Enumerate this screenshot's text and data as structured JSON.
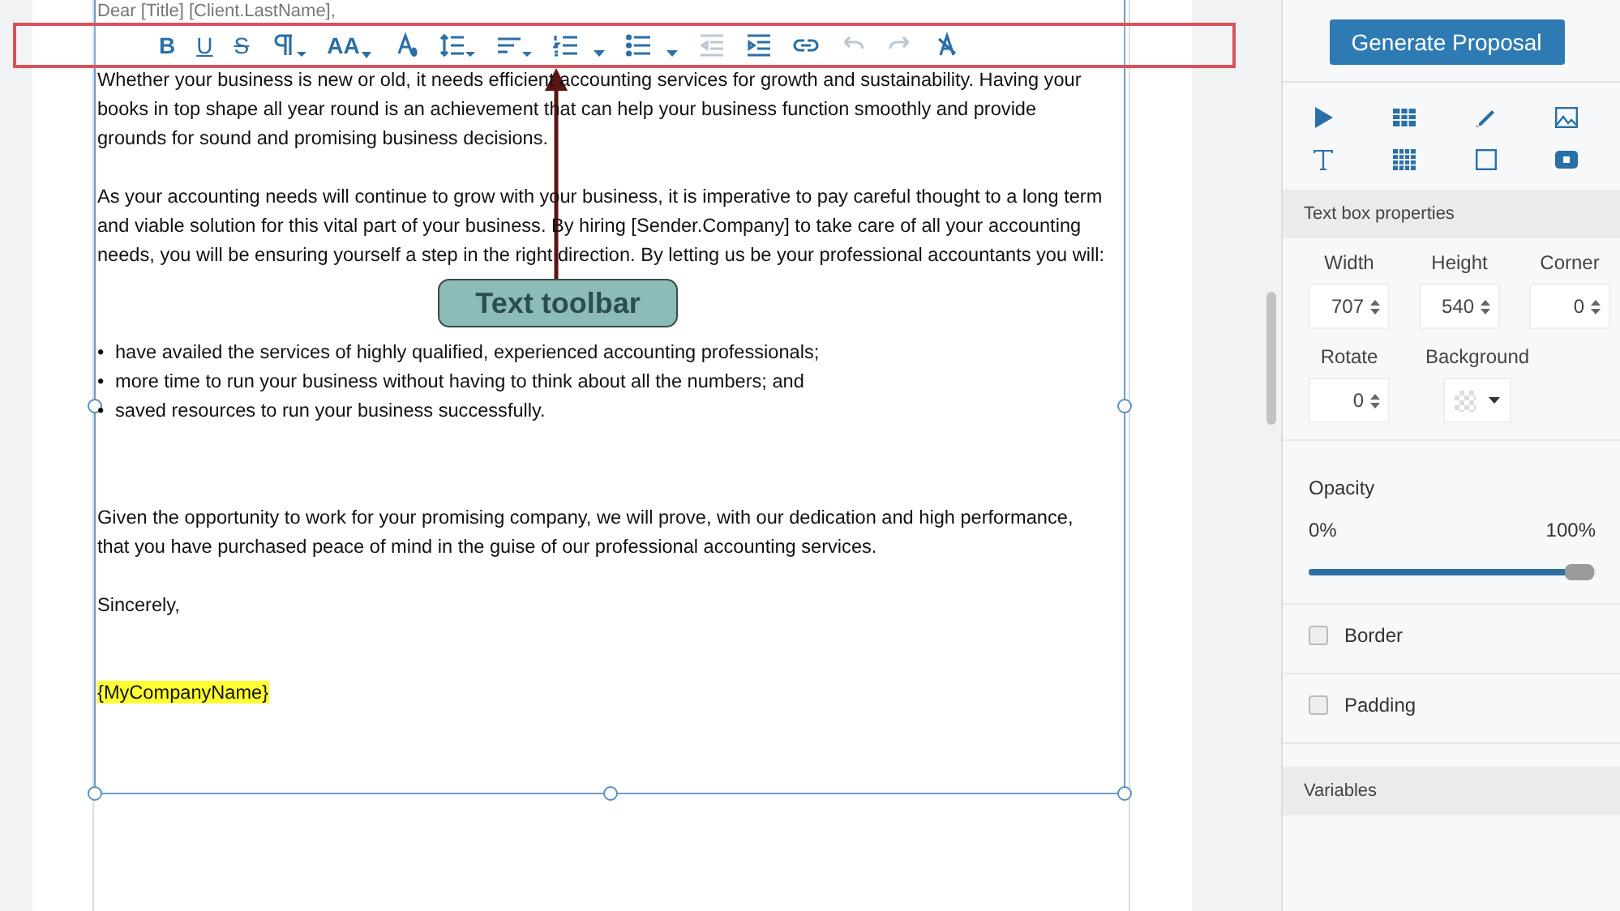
{
  "toolbar": {
    "buttons": [
      {
        "kind": "glyph",
        "label": "B",
        "disabled": false,
        "dropdown": false
      },
      {
        "kind": "glyph",
        "label": "U",
        "disabled": false,
        "dropdown": false
      },
      {
        "kind": "glyph",
        "label": "S",
        "disabled": false,
        "dropdown": false
      },
      {
        "kind": "icon",
        "disabled": false,
        "dropdown": true
      },
      {
        "kind": "glyph",
        "label": "AA",
        "disabled": false,
        "dropdown": true
      },
      {
        "kind": "icon",
        "disabled": false,
        "dropdown": false
      },
      {
        "kind": "icon",
        "disabled": false,
        "dropdown": true
      },
      {
        "kind": "icon",
        "disabled": false,
        "dropdown": true
      },
      {
        "kind": "icon",
        "disabled": false,
        "dropdown": true
      },
      {
        "kind": "icon",
        "disabled": false,
        "dropdown": true
      },
      {
        "kind": "icon",
        "disabled": true,
        "dropdown": false
      },
      {
        "kind": "icon",
        "disabled": false,
        "dropdown": false
      },
      {
        "kind": "icon",
        "disabled": false,
        "dropdown": false
      },
      {
        "kind": "icon",
        "disabled": true,
        "dropdown": false
      },
      {
        "kind": "icon",
        "disabled": true,
        "dropdown": false
      },
      {
        "kind": "icon",
        "disabled": false,
        "dropdown": false
      }
    ]
  },
  "callout": {
    "label": "Text toolbar"
  },
  "document": {
    "greeting": "Dear [Title] [Client.LastName],",
    "blocks": [
      {
        "kind": "paragraph",
        "text": "Whether your business is new or old, it needs efficient accounting services for growth and sustainability. Having your books in top shape all year round is an achievement that can help your business function smoothly and provide grounds for sound and promising business decisions."
      },
      {
        "kind": "paragraph",
        "text": "As your accounting needs will continue to grow with your business, it is imperative to pay careful thought to a long term and viable solution for this vital part of your business. By hiring [Sender.Company] to take care of all your accounting needs, you will be ensuring yourself a step in the right direction. By letting us be your professional accountants you will:"
      },
      {
        "kind": "list",
        "items": [
          {
            "bullet": "•",
            "text": "have availed the services of highly qualified, experienced accounting professionals;"
          },
          {
            "bullet": "•",
            "text": "more time to run your business without having to think about all the numbers; and"
          },
          {
            "bullet": "•",
            "text": "saved resources to run your business successfully."
          }
        ]
      },
      {
        "kind": "paragraph",
        "text": "Given the opportunity to work for your promising company, we will prove, with our dedication and high performance, that you have purchased peace of mind in the guise of our professional accounting services."
      },
      {
        "kind": "paragraph",
        "text": "Sincerely,"
      },
      {
        "kind": "highlight",
        "text": "{MyCompanyName}"
      }
    ]
  },
  "sidebar": {
    "primary_button": "Generate Proposal",
    "section_title": "Text box properties",
    "size_fields": [
      {
        "label": "Width",
        "value": "707"
      },
      {
        "label": "Height",
        "value": "540"
      },
      {
        "label": "Corner",
        "value": "0"
      }
    ],
    "rotate": {
      "label": "Rotate",
      "value": "0"
    },
    "background": {
      "label": "Background"
    },
    "opacity": {
      "label": "Opacity",
      "min_label": "0%",
      "max_label": "100%",
      "level": 0.97
    },
    "checkboxes": [
      {
        "label": "Border",
        "checked": false
      },
      {
        "label": "Padding",
        "checked": false
      }
    ],
    "variables_title": "Variables"
  }
}
